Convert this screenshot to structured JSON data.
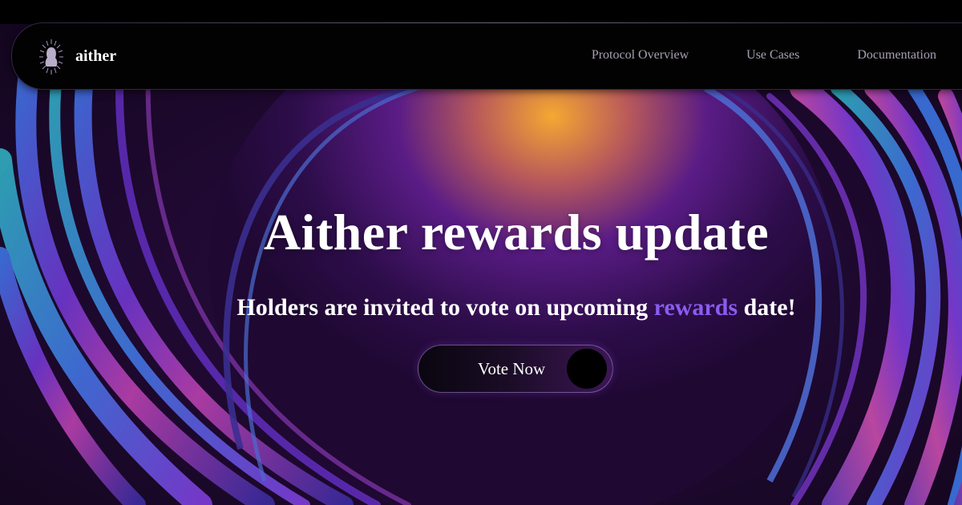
{
  "brand": {
    "name": "aither",
    "logo_icon": "aither-logo-icon"
  },
  "nav": {
    "items": [
      {
        "label": "Protocol Overview"
      },
      {
        "label": "Use Cases"
      },
      {
        "label": "Documentation"
      }
    ]
  },
  "hero": {
    "title": "Aither rewards update",
    "subtitle_before": "Holders are invited to vote on upcoming ",
    "subtitle_accent": "rewards",
    "subtitle_after": " date!",
    "cta_label": "Vote Now"
  },
  "colors": {
    "accent": "#8a5cf0",
    "nav_text": "#a7a1b1",
    "background": "#000000",
    "glow": "#f0a030"
  }
}
